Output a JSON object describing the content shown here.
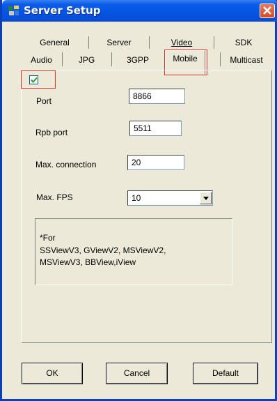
{
  "window": {
    "title": "Server Setup"
  },
  "tabs": {
    "row1": [
      "General",
      "Server",
      "Video",
      "SDK"
    ],
    "row2": [
      "Audio",
      "JPG",
      "3GPP",
      "Mobile",
      "Multicast"
    ],
    "active": "Mobile"
  },
  "mobile": {
    "enabled": true,
    "port": {
      "label": "Port",
      "value": "8866"
    },
    "rpb_port": {
      "label": "Rpb port",
      "value": "5511"
    },
    "max_connection": {
      "label": "Max. connection",
      "value": "20"
    },
    "max_fps": {
      "label": "Max. FPS",
      "value": "10"
    },
    "note": [
      "*For",
      "SSViewV3, GViewV2, MSViewV2,",
      "MSViewV3, BBView,iView"
    ]
  },
  "buttons": {
    "ok": "OK",
    "cancel": "Cancel",
    "default": "Default"
  },
  "colors": {
    "titlebar": "#0554e3",
    "face": "#ece9d8",
    "highlight": "#e2302b"
  },
  "icons": {
    "app": "app-icon",
    "close": "close-icon",
    "check": "check-icon",
    "dropdown": "chevron-down-icon"
  }
}
